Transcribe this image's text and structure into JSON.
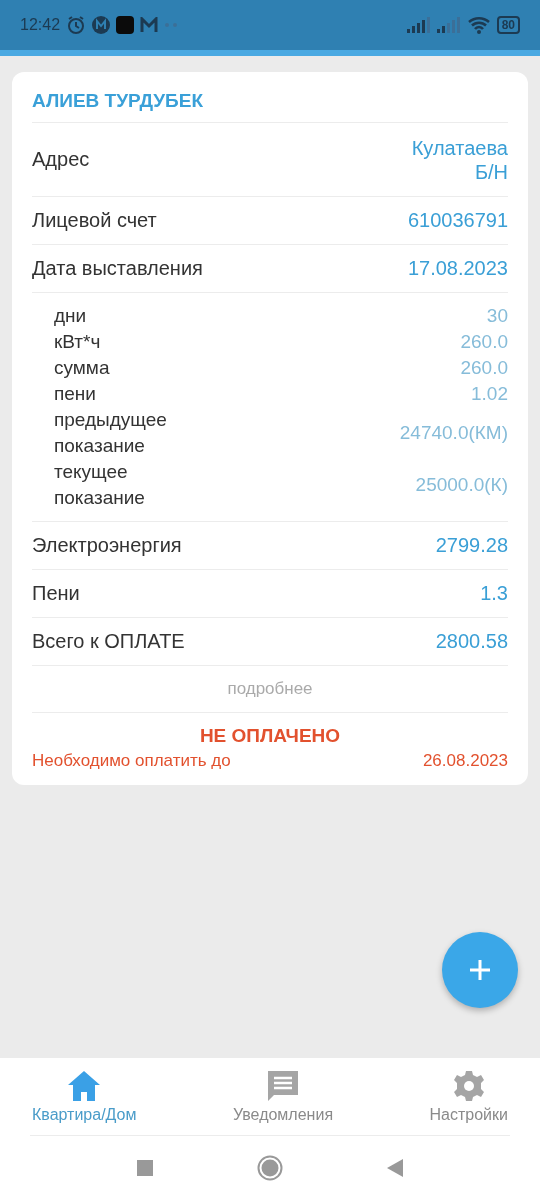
{
  "status_bar": {
    "time": "12:42",
    "battery": "80"
  },
  "card": {
    "title": "АЛИЕВ ТУРДУБЕК",
    "fields": [
      {
        "label": "Адрес",
        "value": "Кулатаева Б/Н"
      },
      {
        "label": "Лицевой счет",
        "value": "610036791"
      },
      {
        "label": "Дата выставления",
        "value": "17.08.2023"
      }
    ],
    "details": [
      {
        "label": "дни",
        "value": "30"
      },
      {
        "label": "кВт*ч",
        "value": "260.0"
      },
      {
        "label": "сумма",
        "value": "260.0"
      },
      {
        "label": "пени",
        "value": "1.02"
      },
      {
        "label": "предыдущее показание",
        "value": "24740.0(КМ)"
      },
      {
        "label": "текущее показание",
        "value": "25000.0(К)"
      }
    ],
    "totals": [
      {
        "label": "Электроэнергия",
        "value": "2799.28"
      },
      {
        "label": "Пени",
        "value": "1.3"
      },
      {
        "label": "Всего к ОПЛАТЕ",
        "value": "2800.58"
      }
    ],
    "more_link": "подробнее",
    "payment_status": "НЕ ОПЛАЧЕНО",
    "due_label": "Необходимо оплатить до",
    "due_date": "26.08.2023"
  },
  "bottom_nav": [
    {
      "label": "Квартира/Дом",
      "selected": true
    },
    {
      "label": "Уведомления",
      "selected": false
    },
    {
      "label": "Настройки",
      "selected": false
    }
  ]
}
